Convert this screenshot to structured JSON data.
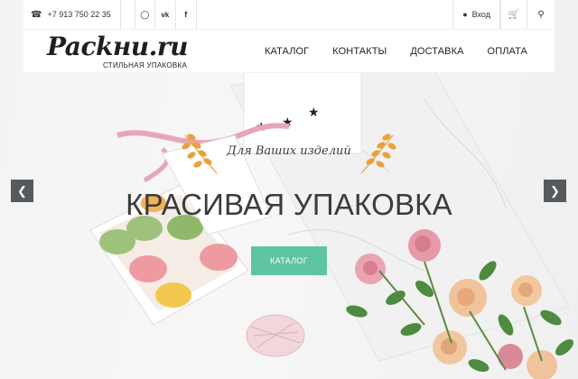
{
  "topbar": {
    "phone": "+7 913 750 22 35",
    "phone_icon": "phone-icon",
    "social_icons": [
      "instagram-icon",
      "vk-icon",
      "facebook-icon"
    ],
    "login_label": "Вход",
    "cart_icon": "cart-icon",
    "search_icon": "search-icon"
  },
  "nav": {
    "logo_text": "Packни.ru",
    "logo_subtitle": "СТИЛЬНАЯ УПАКОВКА",
    "items": [
      "КАТАЛОГ",
      "КОНТАКТЫ",
      "ДОСТАВКА",
      "ОПЛАТА"
    ]
  },
  "slider": {
    "tagline": "Для Ваших изделий",
    "headline": "КРАСИВАЯ УПАКОВКА",
    "button_label": "КАТАЛОГ",
    "prev_icon": "chevron-left-icon",
    "next_icon": "chevron-right-icon"
  },
  "colors": {
    "accent": "#5ec4a1",
    "arrow_bg": "#555a5c",
    "wheat": "#e9a23b",
    "text": "#3c3c3c"
  }
}
